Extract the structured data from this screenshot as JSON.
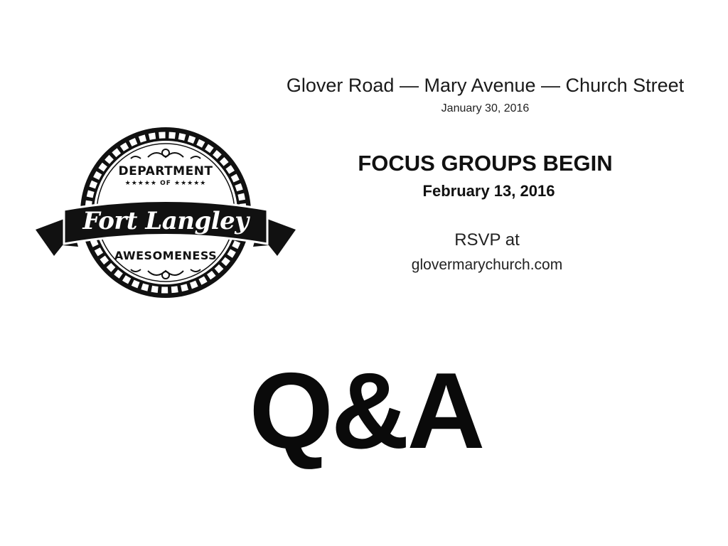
{
  "slide": {
    "streets": "Glover Road — Mary Avenue — Church Street",
    "meeting_date": "January 30, 2016",
    "headline": "FOCUS GROUPS BEGIN",
    "focus_date": "February 13, 2016",
    "rsvp_label": "RSVP at",
    "website": "glovermarychurch.com",
    "qa_title": "Q&A"
  },
  "badge": {
    "top_text": "DEPARTMENT",
    "of_text": "★★★★★   OF   ★★★★★",
    "ribbon_text": "Fort Langley",
    "bottom_text": "AWESOMENESS"
  },
  "colors": {
    "ink": "#111111",
    "background": "#ffffff"
  }
}
